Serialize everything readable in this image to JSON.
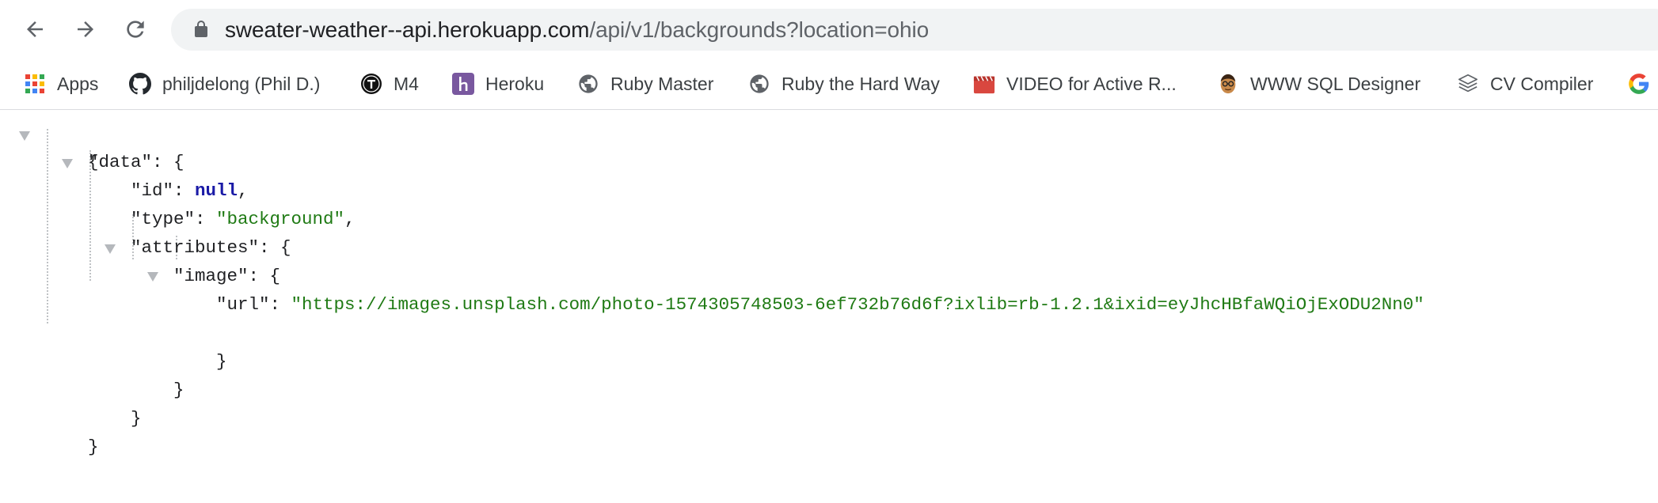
{
  "browser": {
    "url_host": "sweater-weather--api.herokuapp.com",
    "url_path": "/api/v1/backgrounds?location=ohio"
  },
  "bookmarks": [
    {
      "label": "Apps",
      "icon": "apps-grid-icon"
    },
    {
      "label": "philjdelong (Phil D.)",
      "icon": "github-icon"
    },
    {
      "label": "M4",
      "icon": "turing-icon"
    },
    {
      "label": "Heroku",
      "icon": "heroku-icon"
    },
    {
      "label": "Ruby Master",
      "icon": "globe-icon"
    },
    {
      "label": "Ruby the Hard Way",
      "icon": "globe-icon"
    },
    {
      "label": "VIDEO for Active R...",
      "icon": "video-icon"
    },
    {
      "label": "WWW SQL Designer",
      "icon": "avatar-icon"
    },
    {
      "label": "CV Compiler",
      "icon": "layers-icon"
    },
    {
      "label": "",
      "icon": "google-icon"
    }
  ],
  "json": {
    "open_root": "{",
    "data_key": "\"data\"",
    "colon": ": ",
    "open_brace": "{",
    "comma": ",",
    "id_key": "\"id\"",
    "id_value": "null",
    "type_key": "\"type\"",
    "type_value": "\"background\"",
    "attributes_key": "\"attributes\"",
    "image_key": "\"image\"",
    "url_key": "\"url\"",
    "url_value": "\"https://images.unsplash.com/photo-1574305748503-6ef732b76d6f?ixlib=rb-1.2.1&ixid=eyJhcHBfaWQiOjExODU2Nn0\"",
    "close_brace": "}"
  },
  "colors": {
    "string": "#1f7a14",
    "null": "#1a1aa6",
    "triangle": "#b5b8bc"
  }
}
